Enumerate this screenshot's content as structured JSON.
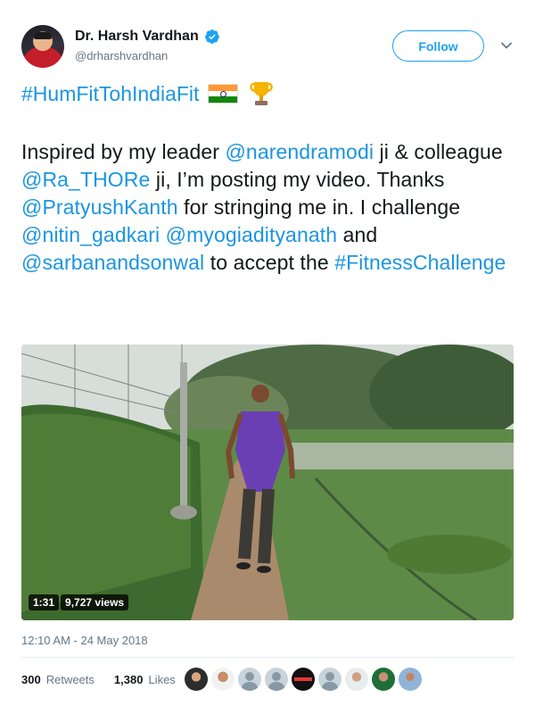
{
  "author": {
    "display_name": "Dr. Harsh Vardhan",
    "handle": "@drharshvardhan",
    "verified": true
  },
  "header": {
    "follow_label": "Follow",
    "menu_icon": "chevron-down-icon"
  },
  "tweet": {
    "hashtag_title": "#HumFitTohIndiaFit",
    "emoji_icons": [
      "india-flag-icon",
      "trophy-icon"
    ],
    "body": [
      {
        "t": "Inspired by my leader ",
        "link": false
      },
      {
        "t": "@narendramodi",
        "link": true
      },
      {
        "t": " ji & colleague ",
        "link": false
      },
      {
        "t": "@Ra_THORe",
        "link": true
      },
      {
        "t": " ji, I’m posting my video. Thanks ",
        "link": false
      },
      {
        "t": "@PratyushKanth",
        "link": true
      },
      {
        "t": " for stringing me in. I challenge ",
        "link": false
      },
      {
        "t": "@nitin_gadkari",
        "link": true
      },
      {
        "t": " ",
        "link": false
      },
      {
        "t": "@myogiadityanath",
        "link": true
      },
      {
        "t": " and ",
        "link": false
      },
      {
        "t": "@sarbanandsonwal",
        "link": true
      },
      {
        "t": " to accept the ",
        "link": false
      },
      {
        "t": "#FitnessChallenge",
        "link": true
      }
    ]
  },
  "video": {
    "duration": "1:31",
    "views": "9,727 views"
  },
  "meta": {
    "timestamp": "12:10 AM - 24 May 2018"
  },
  "stats": {
    "retweets_count": "300",
    "retweets_label": "Retweets",
    "likes_count": "1,380",
    "likes_label": "Likes"
  },
  "colors": {
    "link": "#1b95e0",
    "follow": "#1da1f2",
    "muted": "#657786"
  }
}
